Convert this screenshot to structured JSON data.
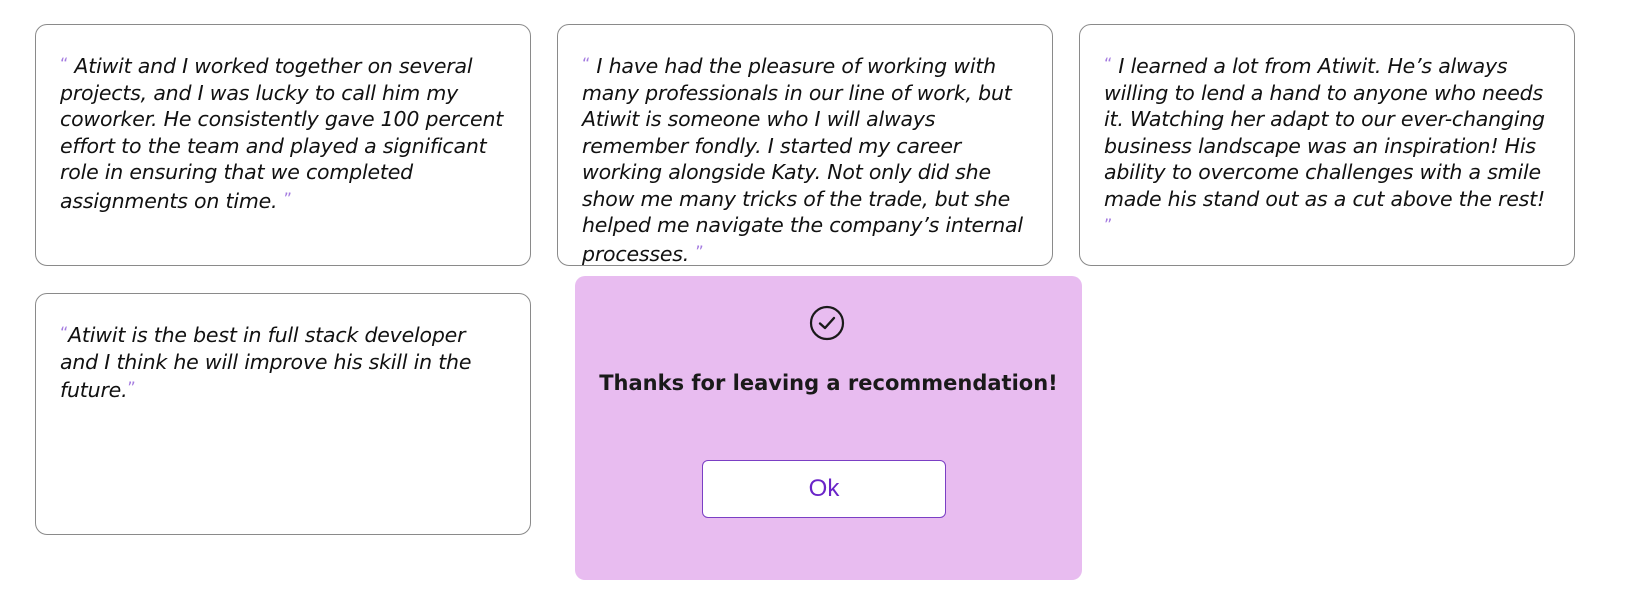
{
  "recommendations": [
    {
      "open_quote": "“",
      "text": "Atiwit and I worked together on several projects, and I was lucky to call him my coworker. He consistently gave 100 percent effort to the team and played a significant role in ensuring that we completed assignments on time.",
      "close_quote": "”"
    },
    {
      "open_quote": "“",
      "text": "I have had the pleasure of working with many professionals in our line of work, but Atiwit is someone who I will always remember fondly. I started my career working alongside Katy. Not only did she show me many tricks of the trade, but she helped me navigate the company’s internal processes.",
      "close_quote": "”"
    },
    {
      "open_quote": "“",
      "text": "I learned a lot from Atiwit. He’s always willing to lend a hand to anyone who needs it. Watching her adapt to our ever-changing business landscape was an inspiration! His ability to overcome challenges with a smile made his stand out as a cut above the rest!",
      "close_quote": "”"
    },
    {
      "open_quote": "“",
      "text": "Atiwit is the best in full stack developer and I think he will improve his skill in the future.",
      "close_quote": "”"
    }
  ],
  "modal": {
    "icon": "check-circle-icon",
    "message": "Thanks for leaving a recommendation!",
    "ok_label": "Ok"
  },
  "colors": {
    "modal_background": "#e8bcf0",
    "quote_mark": "#a47be0",
    "button_text": "#6a24c8",
    "button_border": "#7b3fc4"
  }
}
